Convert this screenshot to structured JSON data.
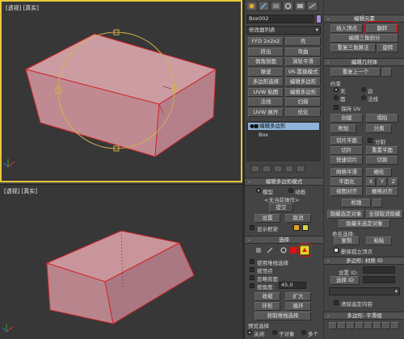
{
  "viewport_top": {
    "label_a": "[透视]",
    "label_b": "[真实]"
  },
  "viewport_bottom": {
    "label_a": "[透视]",
    "label_b": "[真实]"
  },
  "colors": {
    "mesh_fill": "#c9959c",
    "mesh_edge": "#d1262b",
    "gizmo": "#d5b24a",
    "viewport_bg": "#373737",
    "active_border": "#e7c83a",
    "highlight": "#d11111"
  },
  "left_panel": {
    "object_name": "Box002",
    "modifier_list": "修改器列表",
    "buttons": [
      [
        "FFD 2x2x2",
        "壳"
      ],
      [
        "挤出",
        "弯曲"
      ],
      [
        "倒角剖面",
        "涡轮平滑"
      ],
      [
        "噪波",
        "VR-置换模式"
      ],
      [
        "多边形选择",
        "编辑多边形"
      ],
      [
        "UVW 贴图",
        "编辑多边形"
      ],
      [
        "法线",
        "扫描"
      ],
      [
        "UVW 展开",
        "优化"
      ]
    ],
    "stack": {
      "item1": "编辑多边形",
      "item2": "Box"
    },
    "mode_rollout": "编辑多边形模式",
    "mode_model": "模型",
    "mode_anim": "动画",
    "no_op": "<无当前操作>",
    "commit": "提交",
    "settings": "设置",
    "cancel": "取消",
    "show_cage": "显示框架",
    "selection_rollout": "选择",
    "by_vertex": "使用堆栈选择",
    "by_vertex_b": "按顶点",
    "ignore_back": "忽略背面",
    "by_angle": "按角度:",
    "angle_value": "45.0",
    "shrink": "收缩",
    "grow": "扩大",
    "ring": "环形",
    "loop": "循环",
    "get_stack": "获取堆栈选择",
    "preview_title": "预览选择",
    "preview_off": "关闭",
    "preview_sub": "子对象",
    "preview_multi": "多个"
  },
  "right_panel": {
    "edit_elements": "编辑元素",
    "insert_vertex": "插入顶点",
    "flip": "翻转",
    "edit_tri": "编辑三角剖分",
    "retriangulate": "重复三角算法",
    "turn": "旋转",
    "edit_geometry": "编辑几何体",
    "repeat_last": "重复上一个",
    "constraints": "约束",
    "c_none": "无",
    "c_edge": "边",
    "c_face": "面",
    "c_normal": "法线",
    "preserve_uv": "保持 UV",
    "create": "创建",
    "collapse": "塌陷",
    "attach": "附加",
    "detach": "分离",
    "slice_plane": "切片平面",
    "split": "分割",
    "slice": "切片",
    "reset_plane": "重置平面",
    "quickslice": "快速切片",
    "cut": "切割",
    "meshsmooth": "网格平滑",
    "tessellate": "细化",
    "planarize": "平面化",
    "x": "X",
    "y": "Y",
    "z": "Z",
    "view_align": "视图对齐",
    "grid_align": "栅格对齐",
    "relax": "松弛",
    "hide_sel": "隐藏选定对象",
    "unhide_all": "全部取消隐藏",
    "hide_unsel": "隐藏未选定对象",
    "named_sel": "命名选择:",
    "copy": "复制",
    "paste": "粘贴",
    "delete_iso": "删除孤立顶点",
    "material_ids": "多边形: 材质 ID",
    "set_id": "设置 ID:",
    "select_id": "选择 ID",
    "clear_sel": "清除选定内容",
    "smoothing": "多边形: 平滑组"
  }
}
